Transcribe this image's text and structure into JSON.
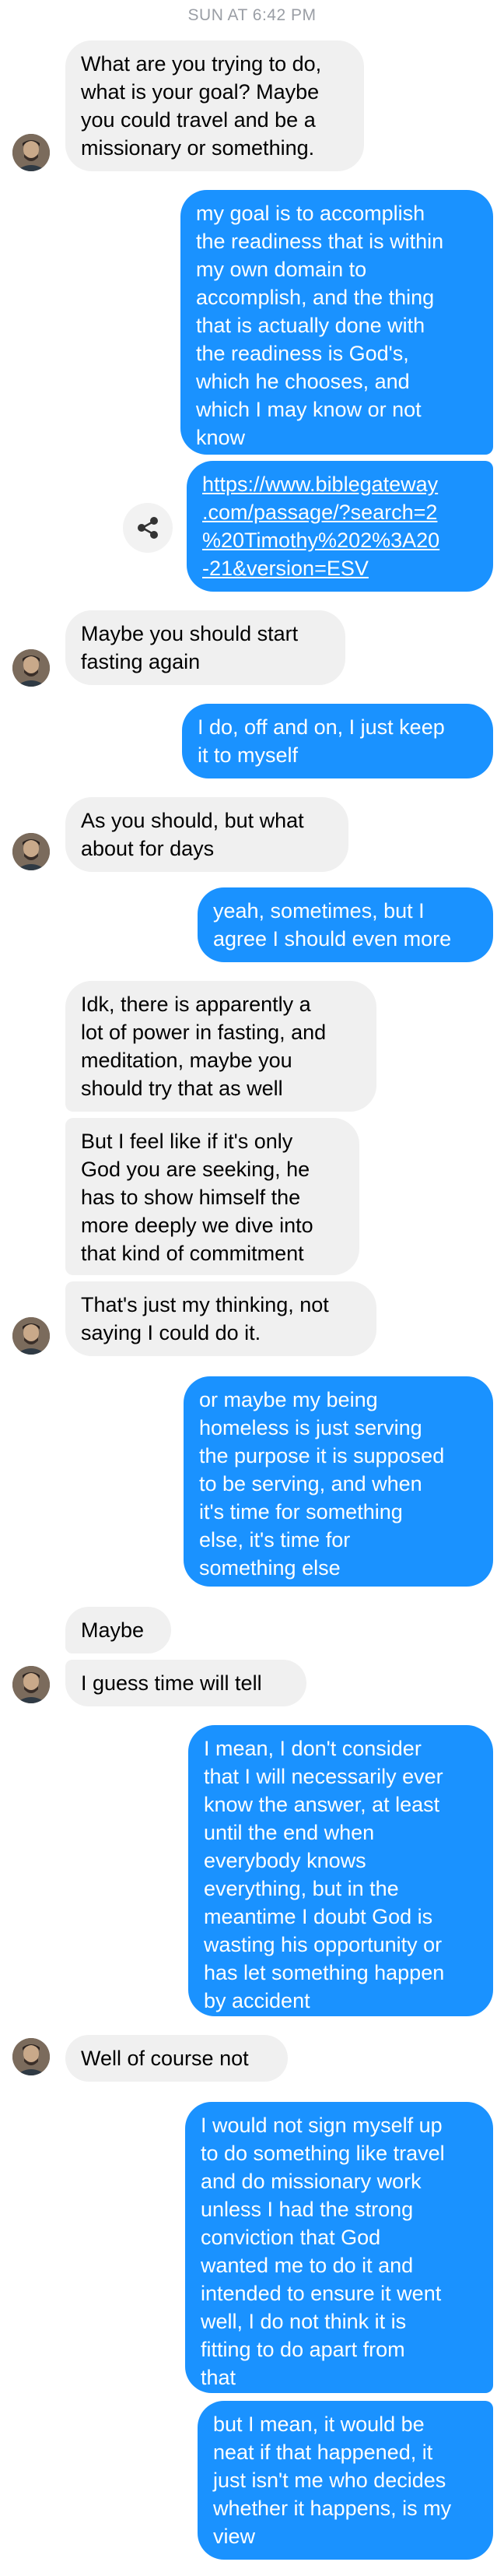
{
  "timestamp": "SUN AT 6:42 PM",
  "messages": [
    {
      "lines": [
        "What are you trying to do,",
        "what is your goal? Maybe",
        "you could travel and be a",
        "missionary or something."
      ]
    },
    {
      "lines": [
        "my goal is to accomplish",
        "the readiness that is within",
        "my own domain to",
        "accomplish, and the thing",
        "that is actually done with",
        "the readiness is God's,",
        "which he chooses, and",
        "which I may know or not",
        "know"
      ]
    },
    {
      "lines": [
        "https://www.biblegateway",
        ".com/passage/?search=2",
        "%20Timothy%202%3A20",
        "-21&version=ESV"
      ]
    },
    {
      "lines": [
        "Maybe you should start",
        "fasting again"
      ]
    },
    {
      "lines": [
        "I do, off and on, I just keep",
        "it to myself"
      ]
    },
    {
      "lines": [
        "As you should, but what",
        "about for days"
      ]
    },
    {
      "lines": [
        "yeah, sometimes, but I",
        "agree I should even more"
      ]
    },
    {
      "lines": [
        "Idk, there is apparently a",
        "lot of power in fasting, and",
        "meditation, maybe you",
        "should try that as well"
      ]
    },
    {
      "lines": [
        "But I feel like if it's only",
        "God you are seeking, he",
        "has to show himself the",
        "more deeply we dive into",
        "that kind of commitment"
      ]
    },
    {
      "lines": [
        "That's just my thinking, not",
        "saying I could do it."
      ]
    },
    {
      "lines": [
        "or maybe my being",
        "homeless is just serving",
        "the purpose it is supposed",
        "to be serving, and when",
        "it's time for something",
        "else, it's time for",
        "something else"
      ]
    },
    {
      "lines": [
        "Maybe"
      ]
    },
    {
      "lines": [
        "I guess time will tell"
      ]
    },
    {
      "lines": [
        "I mean, I don't consider",
        "that I will necessarily ever",
        "know the answer, at least",
        "until the end when",
        "everybody knows",
        "everything, but in the",
        "meantime I doubt God is",
        "wasting his opportunity or",
        "has let something happen",
        "by accident"
      ]
    },
    {
      "lines": [
        "Well of course not"
      ]
    },
    {
      "lines": [
        "I would not sign myself up",
        "to do something like travel",
        "and do missionary work",
        "unless I had the strong",
        "conviction that God",
        "wanted me to do it and",
        "intended to ensure it went",
        "well, I do not think it is",
        "fitting to do apart from",
        "that"
      ]
    },
    {
      "lines": [
        "but I mean, it would be",
        "neat if that happened, it",
        "just isn't me who decides",
        "whether it happens, is my",
        "view"
      ]
    }
  ],
  "icons": {
    "avatar": "contact-avatar",
    "share": "share-icon"
  },
  "colors": {
    "incoming_bg": "#f0f0f0",
    "outgoing_bg": "#1a92ff",
    "timestamp": "#9a9ea5"
  }
}
